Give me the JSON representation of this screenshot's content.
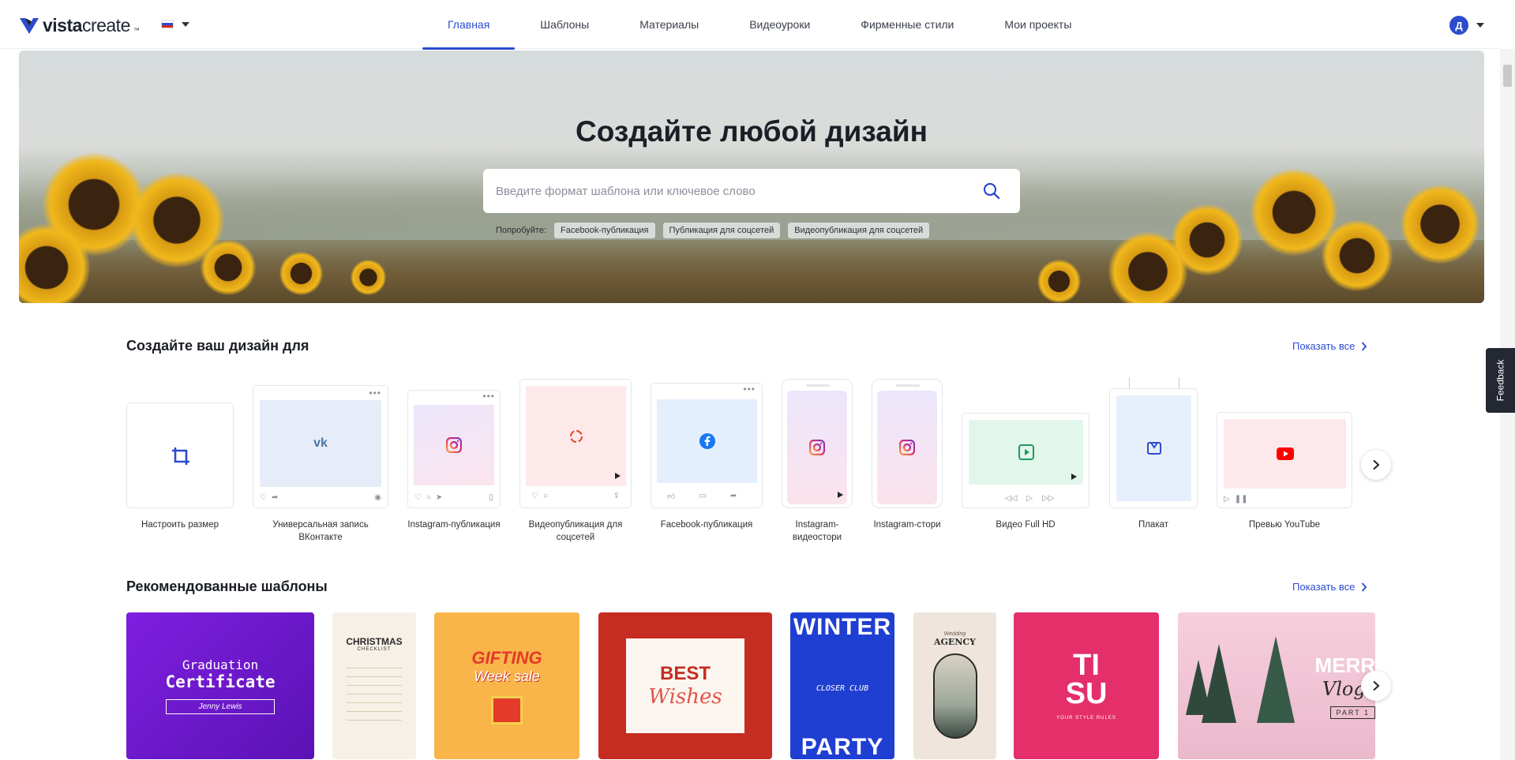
{
  "header": {
    "logo_text_bold": "vista",
    "logo_text_light": "create",
    "logo_tm": "™",
    "nav": [
      {
        "label": "Главная",
        "active": true
      },
      {
        "label": "Шаблоны"
      },
      {
        "label": "Материалы"
      },
      {
        "label": "Видеоуроки"
      },
      {
        "label": "Фирменные стили"
      },
      {
        "label": "Мои проекты"
      }
    ],
    "user_initial": "Д",
    "accent": "#2c4bcf"
  },
  "hero": {
    "title": "Создайте любой дизайн",
    "search_placeholder": "Введите формат шаблона или ключевое слово",
    "try_label": "Попробуйте:",
    "suggestions": [
      "Facebook-публикация",
      "Публикация для соцсетей",
      "Видеопубликация для соцсетей"
    ]
  },
  "formats": {
    "title": "Создайте ваш дизайн для",
    "show_all": "Показать все",
    "items": [
      {
        "label": "Настроить размер",
        "icon": "crop-icon"
      },
      {
        "label": "Универсальная запись ВКонтакте",
        "icon": "vk-icon"
      },
      {
        "label": "Instagram-публикация",
        "icon": "instagram-icon"
      },
      {
        "label": "Видеопубликация для соцсетей",
        "icon": "share-cycle-icon"
      },
      {
        "label": "Facebook-публикация",
        "icon": "facebook-icon"
      },
      {
        "label": "Instagram-видеостори",
        "icon": "instagram-icon"
      },
      {
        "label": "Instagram-стори",
        "icon": "instagram-icon"
      },
      {
        "label": "Видео Full HD",
        "icon": "play-icon"
      },
      {
        "label": "Плакат",
        "icon": "poster-icon"
      },
      {
        "label": "Превью YouTube",
        "icon": "youtube-icon"
      }
    ]
  },
  "templates": {
    "title": "Рекомендованные шаблоны",
    "show_all": "Показать все",
    "items": [
      {
        "line1": "Graduation",
        "line2": "Certificate",
        "line3": "Jenny Lewis",
        "bg": "#6c17c9"
      },
      {
        "line1": "CHRISTMAS",
        "line2": "CHECKLIST",
        "bg": "#f7f0e6"
      },
      {
        "line1": "GIFTING",
        "line2": "Week sale",
        "bg": "#f9b54a"
      },
      {
        "line1": "BEST",
        "line2": "Wishes",
        "bg": "#c62d22"
      },
      {
        "line1": "WINTER",
        "line2": "CLOSER CLUB",
        "line3": "PARTY",
        "bg": "#1f3fd2"
      },
      {
        "line1": "Wedding",
        "line2": "AGENCY",
        "bg": "#efe5dc"
      },
      {
        "line1": "TI",
        "line2": "SU",
        "line3": "YOUR STYLE RULES",
        "bg": "#e42f6a"
      },
      {
        "line1": "MERR",
        "line2": "Vlogs",
        "line3": "PART 1",
        "bg": "#f2c6d6"
      }
    ]
  },
  "feedback_label": "Feedback"
}
